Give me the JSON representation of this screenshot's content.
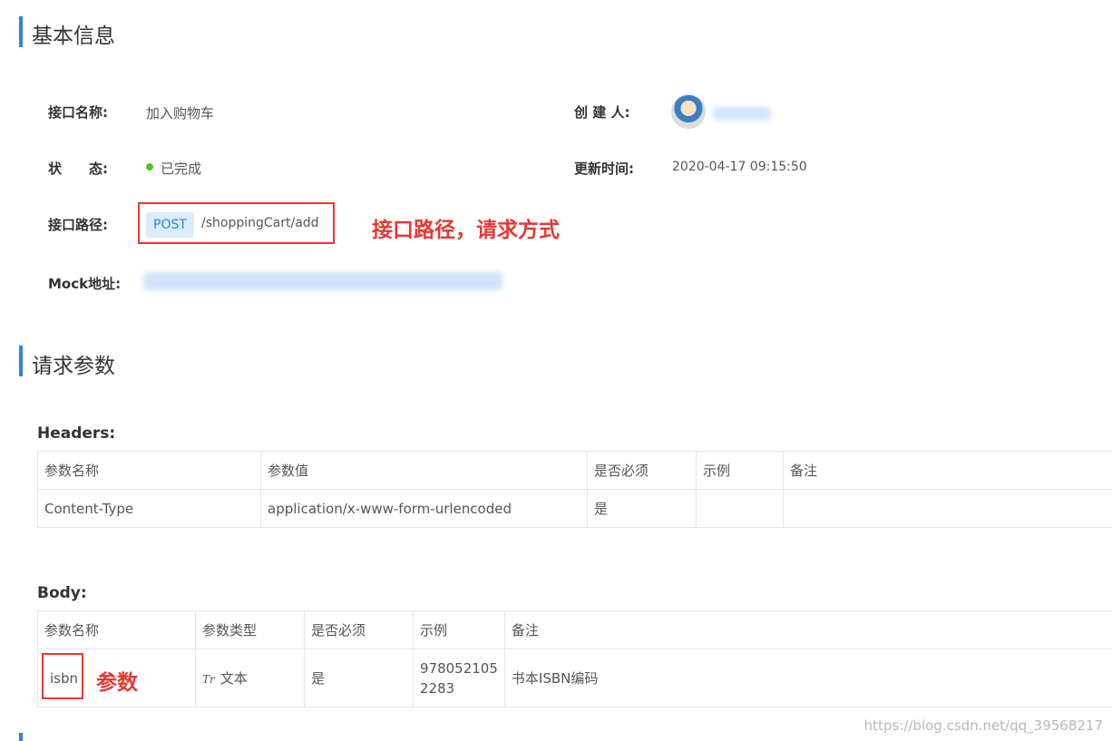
{
  "basic_info": {
    "title": "基本信息",
    "api_name_label": "接口名称:",
    "api_name": "加入购物车",
    "creator_label": "创 建 人:",
    "status_label": "状　　态:",
    "status": "已完成",
    "status_color": "#52c41a",
    "updated_label": "更新时间:",
    "updated_time": "2020-04-17 09:15:50",
    "path_label": "接口路径:",
    "method": "POST",
    "path": "/shoppingCart/add",
    "mock_label": "Mock地址:",
    "path_annotation": "接口路径，请求方式"
  },
  "request_params": {
    "title": "请求参数",
    "headers_label": "Headers:",
    "headers_columns": [
      "参数名称",
      "参数值",
      "是否必须",
      "示例",
      "备注"
    ],
    "headers_rows": [
      [
        "Content-Type",
        "application/x-www-form-urlencoded",
        "是",
        "",
        ""
      ]
    ],
    "body_label": "Body:",
    "body_columns": [
      "参数名称",
      "参数类型",
      "是否必须",
      "示例",
      "备注"
    ],
    "body_rows": [
      {
        "name": "isbn",
        "type_icon": "Tr",
        "type": "文本",
        "required": "是",
        "example_line1": "978052105",
        "example_line2": "2283",
        "note": "书本ISBN编码"
      }
    ],
    "param_annotation": "参数"
  },
  "watermark": "https://blog.csdn.net/qq_39568217",
  "colors": {
    "accent": "#2f86d6",
    "annotation": "#e53935"
  }
}
